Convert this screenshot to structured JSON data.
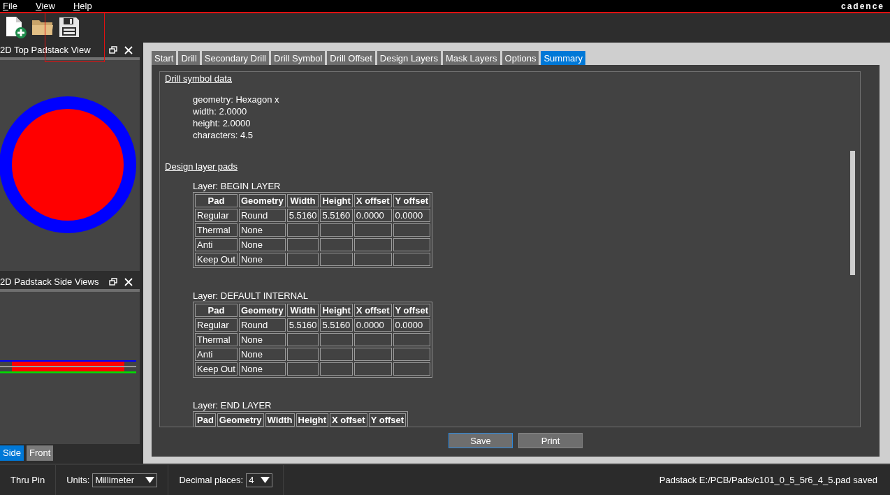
{
  "menu": [
    {
      "label": "File"
    },
    {
      "label": "View"
    },
    {
      "label": "Help"
    }
  ],
  "logo": "cadence",
  "toolbar": [
    {
      "kind": "new",
      "highlighted": false
    },
    {
      "kind": "open",
      "highlighted": false
    },
    {
      "kind": "save",
      "highlighted": true
    }
  ],
  "top_view": {
    "title": "2D Top Padstack View"
  },
  "side_view": {
    "title": "2D Padstack Side Views",
    "tabs": [
      {
        "label": "Side",
        "selected": true
      },
      {
        "label": "Front",
        "selected": false
      }
    ]
  },
  "tabs": [
    {
      "label": "Start",
      "selected": false
    },
    {
      "label": "Drill",
      "selected": false
    },
    {
      "label": "Secondary Drill",
      "selected": false
    },
    {
      "label": "Drill Symbol",
      "selected": false
    },
    {
      "label": "Drill Offset",
      "selected": false
    },
    {
      "label": "Design Layers",
      "selected": false
    },
    {
      "label": "Mask Layers",
      "selected": false
    },
    {
      "label": "Options",
      "selected": false
    },
    {
      "label": "Summary",
      "selected": true
    }
  ],
  "summary": {
    "drill_symbol": {
      "heading": "Drill symbol data",
      "lines": [
        "geometry: Hexagon x",
        "width: 2.0000",
        "height: 2.0000",
        "characters: 4.5"
      ]
    },
    "pads_heading": "Design layer pads",
    "layers": [
      {
        "title": "Layer: BEGIN LAYER",
        "columns": [
          "Pad",
          "Geometry",
          "Width",
          "Height",
          "X offset",
          "Y offset"
        ],
        "rows": [
          [
            "Regular",
            "Round",
            "5.5160",
            "5.5160",
            "0.0000",
            "0.0000"
          ],
          [
            "Thermal",
            "None"
          ],
          [
            "Anti",
            "None"
          ],
          [
            "Keep Out",
            "None"
          ]
        ]
      },
      {
        "title": "Layer: DEFAULT INTERNAL",
        "columns": [
          "Pad",
          "Geometry",
          "Width",
          "Height",
          "X offset",
          "Y offset"
        ],
        "rows": [
          [
            "Regular",
            "Round",
            "5.5160",
            "5.5160",
            "0.0000",
            "0.0000"
          ],
          [
            "Thermal",
            "None"
          ],
          [
            "Anti",
            "None"
          ],
          [
            "Keep Out",
            "None"
          ]
        ]
      },
      {
        "title": "Layer: END LAYER",
        "columns": [
          "Pad",
          "Geometry",
          "Width",
          "Height",
          "X offset",
          "Y offset"
        ]
      }
    ]
  },
  "buttons": [
    {
      "label": "Save",
      "focused": true
    },
    {
      "label": "Print",
      "focused": false
    }
  ],
  "status_bar": {
    "pin_type": "Thru Pin",
    "units": {
      "label": "Units:",
      "value": "Millimeter"
    },
    "decimals": {
      "label": "Decimal places:",
      "value": "4"
    },
    "message": "Padstack E:/PCB/Pads/c101_0_5_5r6_4_5.pad saved"
  }
}
